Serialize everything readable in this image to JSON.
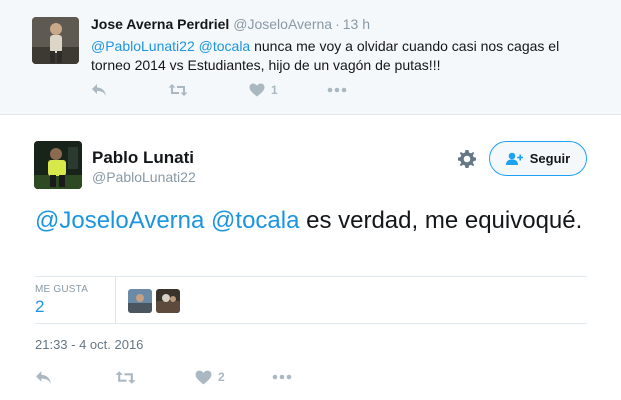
{
  "reply_tweet": {
    "name": "Jose Averna Perdriel",
    "handle": "@JoseloAverna",
    "separator": "·",
    "time": "13 h",
    "mention1": "@PabloLunati22",
    "mention2": "@tocala",
    "text": " nunca me voy a olvidar cuando casi nos cagas el torneo 2014 vs Estudiantes, hijo de un vagón de putas!!!",
    "like_count": "1"
  },
  "main_tweet": {
    "name": "Pablo Lunati",
    "handle": "@PabloLunati22",
    "follow_label": "Seguir",
    "mention1": "@JoseloAverna",
    "mention2": "@tocala",
    "text": " es verdad, me equivoqué.",
    "likes_label": "ME GUSTA",
    "likes_count": "2",
    "timestamp": "21:33 - 4 oct. 2016",
    "like_count": "2"
  },
  "icons": {
    "reply": "reply-icon",
    "retweet": "retweet-icon",
    "like": "heart-icon",
    "more": "more-icon",
    "gear": "gear-icon",
    "follow": "follow-user-icon"
  },
  "colors": {
    "link": "#1b95e0",
    "muted": "#8899a6",
    "icon": "#aab8c2",
    "border": "#e1e8ed",
    "reply_bg": "#f5f8fa"
  }
}
